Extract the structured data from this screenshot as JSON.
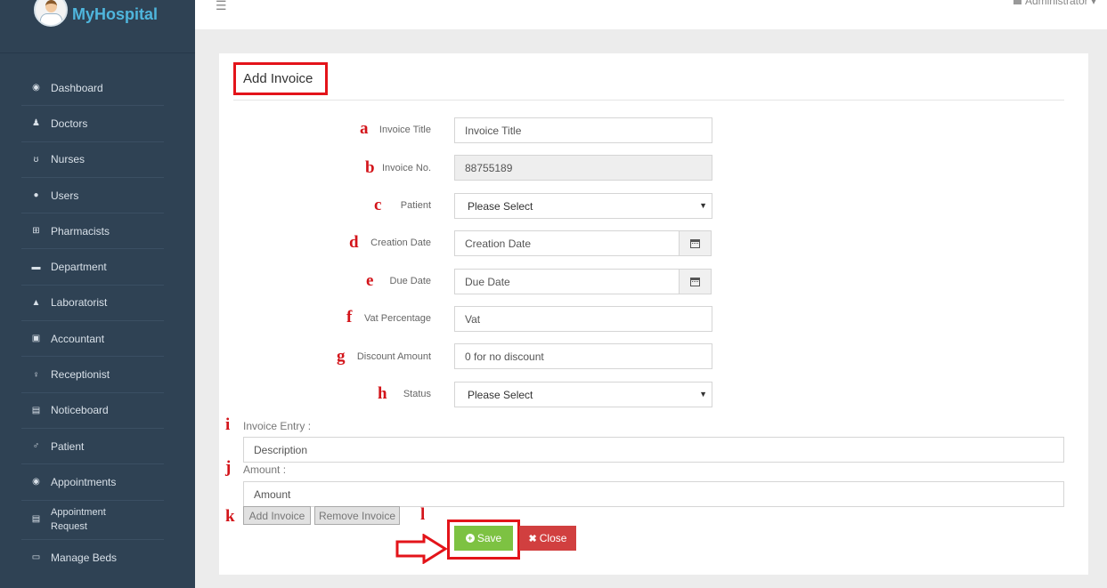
{
  "app": {
    "name": "MyHospital"
  },
  "topbar": {
    "user": "Administrator"
  },
  "sidebar": {
    "items": [
      {
        "label": "Dashboard",
        "icon": "dashboard-icon"
      },
      {
        "label": "Doctors",
        "icon": "user-md-icon"
      },
      {
        "label": "Nurses",
        "icon": "stethoscope-icon"
      },
      {
        "label": "Users",
        "icon": "user-icon"
      },
      {
        "label": "Pharmacists",
        "icon": "plus-square-icon"
      },
      {
        "label": "Department",
        "icon": "briefcase-icon"
      },
      {
        "label": "Laboratorist",
        "icon": "flask-icon"
      },
      {
        "label": "Accountant",
        "icon": "money-icon"
      },
      {
        "label": "Receptionist",
        "icon": "female-icon"
      },
      {
        "label": "Noticeboard",
        "icon": "file-icon"
      },
      {
        "label": "Patient",
        "icon": "male-icon"
      },
      {
        "label": "Appointments",
        "icon": "dashboard-icon"
      },
      {
        "label": "Appointment\nRequest",
        "icon": "list-alt-icon"
      },
      {
        "label": "Manage Beds",
        "icon": "bed-icon"
      }
    ]
  },
  "form": {
    "title": "Add Invoice",
    "fields": {
      "invoice_title": {
        "letter": "a",
        "label": "Invoice Title",
        "placeholder": "Invoice Title"
      },
      "invoice_no": {
        "letter": "b",
        "label": "Invoice No.",
        "value": "88755189"
      },
      "patient": {
        "letter": "c",
        "label": "Patient",
        "value": "Please Select"
      },
      "creation_date": {
        "letter": "d",
        "label": "Creation Date",
        "placeholder": "Creation Date"
      },
      "due_date": {
        "letter": "e",
        "label": "Due Date",
        "placeholder": "Due Date"
      },
      "vat": {
        "letter": "f",
        "label": "Vat Percentage",
        "placeholder": "Vat"
      },
      "discount": {
        "letter": "g",
        "label": "Discount Amount",
        "placeholder": "0 for no discount"
      },
      "status": {
        "letter": "h",
        "label": "Status",
        "value": "Please Select"
      }
    },
    "entry": {
      "letter_i": "i",
      "label": "Invoice Entry :",
      "description_placeholder": "Description",
      "letter_j": "j",
      "amount_label": "Amount :",
      "amount_placeholder": "Amount",
      "letter_k": "k",
      "add_label": "Add Invoice",
      "remove_label": "Remove Invoice",
      "letter_l": "l"
    },
    "actions": {
      "save_label": "Save",
      "close_label": "Close"
    }
  },
  "colors": {
    "sidebar": "#2f4254",
    "annotation": "#e3141a",
    "save": "#7dc242",
    "close": "#d13f3f",
    "brand": "#4fb6dd"
  }
}
